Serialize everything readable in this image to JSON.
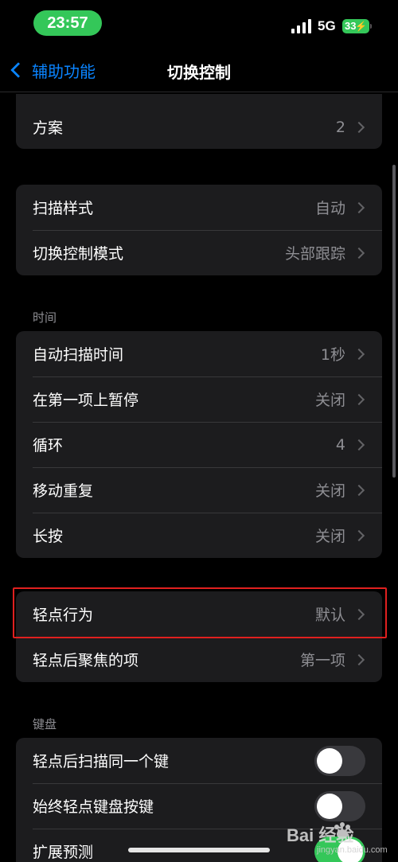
{
  "status_bar": {
    "time": "23:57",
    "network": "5G",
    "battery": "33"
  },
  "nav": {
    "back_label": "辅助功能",
    "title": "切换控制"
  },
  "group_top": {
    "rows": [
      {
        "label": "方案",
        "value": "2"
      }
    ]
  },
  "group_scan": {
    "rows": [
      {
        "label": "扫描样式",
        "value": "自动"
      },
      {
        "label": "切换控制模式",
        "value": "头部跟踪"
      }
    ]
  },
  "section_time": {
    "header": "时间"
  },
  "group_time": {
    "rows": [
      {
        "label": "自动扫描时间",
        "value": "1秒"
      },
      {
        "label": "在第一项上暂停",
        "value": "关闭"
      },
      {
        "label": "循环",
        "value": "4"
      },
      {
        "label": "移动重复",
        "value": "关闭"
      },
      {
        "label": "长按",
        "value": "关闭"
      }
    ]
  },
  "group_tap": {
    "rows": [
      {
        "label": "轻点行为",
        "value": "默认"
      },
      {
        "label": "轻点后聚焦的项",
        "value": "第一项"
      }
    ]
  },
  "section_keyboard": {
    "header": "键盘"
  },
  "group_keyboard": {
    "rows": [
      {
        "label": "轻点后扫描同一个键",
        "toggle": false
      },
      {
        "label": "始终轻点键盘按键",
        "toggle": false
      },
      {
        "label": "扩展预测",
        "toggle": true
      }
    ]
  },
  "watermark": {
    "text": "Bai 经验",
    "sub": "jingyan.baidu.com"
  },
  "colors": {
    "accent": "#0a84ff",
    "toggle_on": "#34c759",
    "highlight": "#e0201f"
  }
}
